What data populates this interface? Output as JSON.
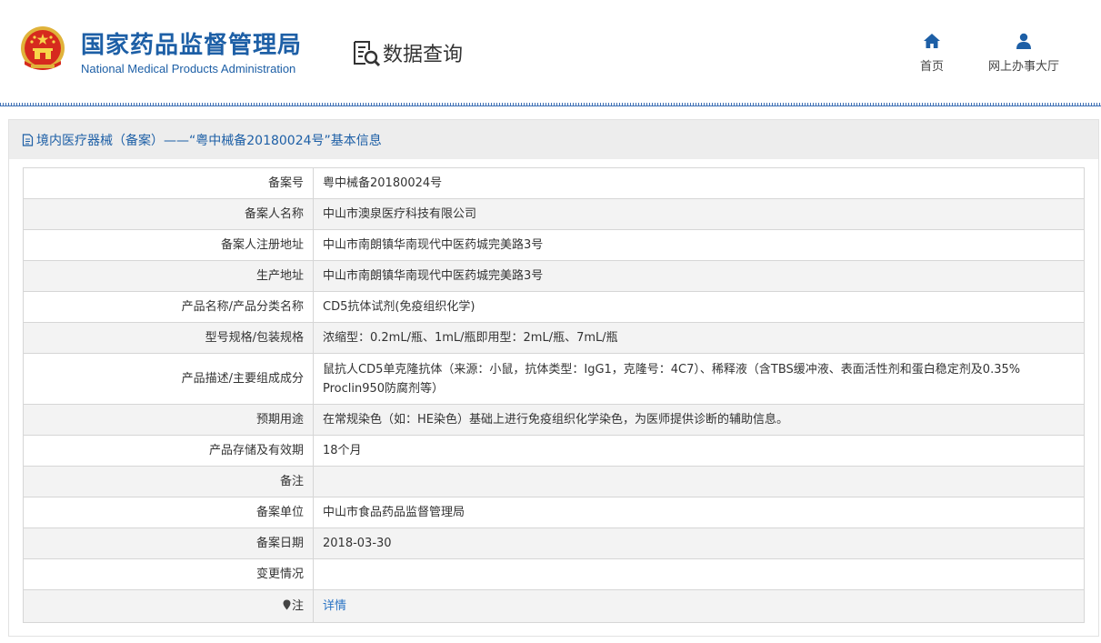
{
  "header": {
    "logo_cn": "国家药品监督管理局",
    "logo_en": "National Medical Products Administration",
    "section_title": "数据查询",
    "nav": [
      {
        "label": "首页",
        "icon": "home-icon"
      },
      {
        "label": "网上办事大厅",
        "icon": "user-icon"
      }
    ]
  },
  "panel": {
    "title": "境内医疗器械（备案）——“粤中械备20180024号”基本信息",
    "rows": [
      {
        "label": "备案号",
        "value": "粤中械备20180024号"
      },
      {
        "label": "备案人名称",
        "value": "中山市澳泉医疗科技有限公司"
      },
      {
        "label": "备案人注册地址",
        "value": "中山市南朗镇华南现代中医药城完美路3号"
      },
      {
        "label": "生产地址",
        "value": "中山市南朗镇华南现代中医药城完美路3号"
      },
      {
        "label": "产品名称/产品分类名称",
        "value": "CD5抗体试剂(免疫组织化学)"
      },
      {
        "label": "型号规格/包装规格",
        "value": "浓缩型：0.2mL/瓶、1mL/瓶即用型：2mL/瓶、7mL/瓶"
      },
      {
        "label": "产品描述/主要组成成分",
        "value_line1": "鼠抗人CD5单克隆抗体（来源：小鼠，抗体类型：IgG1，克隆号：4C7）、稀释液（含TBS缓冲液、表面活性剂和蛋白稳定剂及0.35%",
        "value_line2": "Proclin950防腐剂等）"
      },
      {
        "label": "预期用途",
        "value": "在常规染色（如：HE染色）基础上进行免疫组织化学染色，为医师提供诊断的辅助信息。"
      },
      {
        "label": "产品存储及有效期",
        "value": "18个月"
      },
      {
        "label": "备注",
        "value": ""
      },
      {
        "label": "备案单位",
        "value": "中山市食品药品监督管理局"
      },
      {
        "label": "备案日期",
        "value": "2018-03-30"
      },
      {
        "label": "变更情况",
        "value": ""
      },
      {
        "label": "注",
        "value": "详情",
        "icon": "pin-icon"
      }
    ]
  },
  "colors": {
    "brand_blue": "#1d5fa6",
    "link_blue": "#2a73c4",
    "head_bg": "#ededed",
    "row_alt": "#f3f3f3"
  }
}
